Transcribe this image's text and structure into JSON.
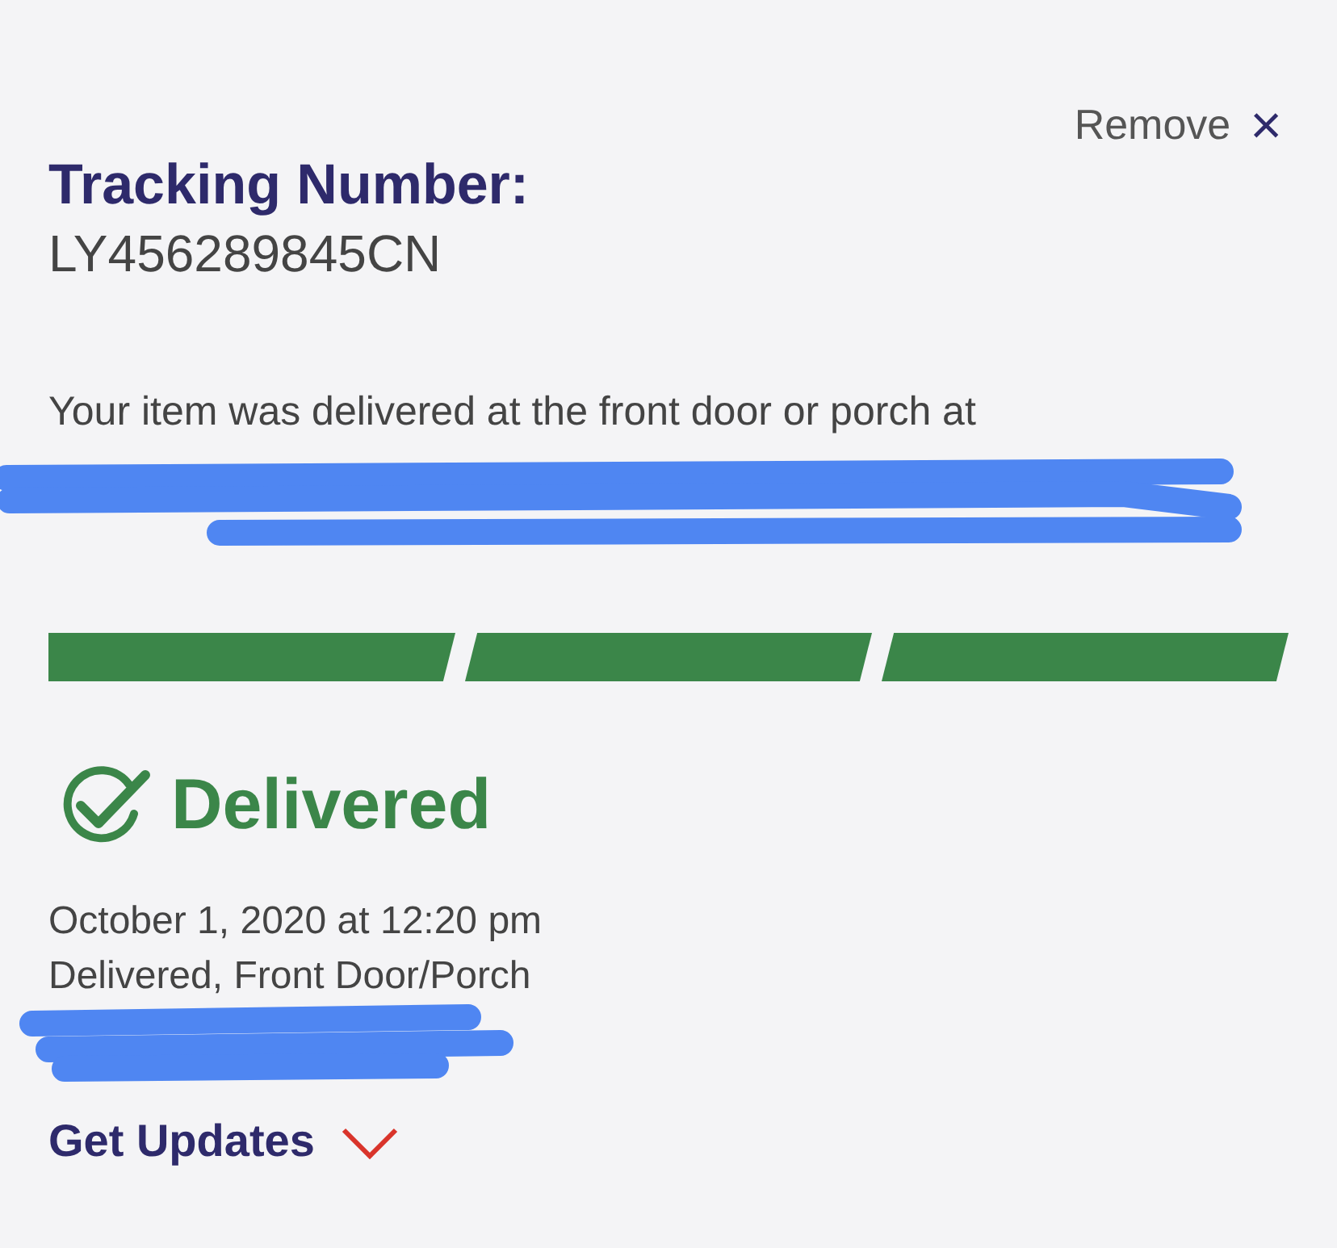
{
  "remove": {
    "label": "Remove",
    "icon": "×"
  },
  "tracking": {
    "label": "Tracking Number:",
    "number": "LY456289845CN"
  },
  "message": "Your item was delivered at the front door or porch at",
  "progress": [
    {
      "complete": true
    },
    {
      "complete": true
    },
    {
      "complete": true
    }
  ],
  "status": {
    "label": "Delivered",
    "date": "October 1, 2020 at 12:20 pm",
    "detail": "Delivered, Front Door/Porch"
  },
  "updates": {
    "label": "Get Updates",
    "expanded": false
  }
}
